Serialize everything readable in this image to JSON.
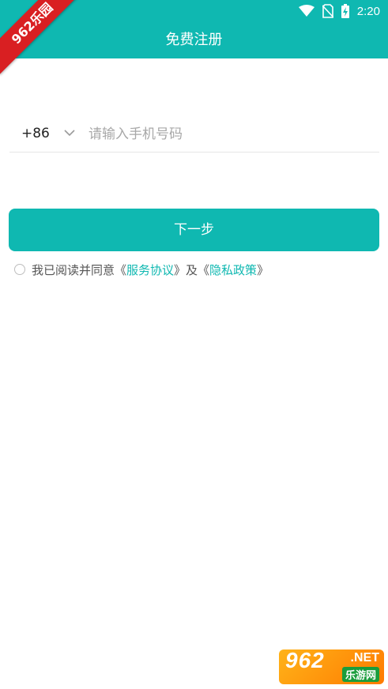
{
  "status_bar": {
    "time": "2:20"
  },
  "ribbon": {
    "text": "962乐园"
  },
  "app_bar": {
    "title": "免费注册"
  },
  "form": {
    "country_code": "+86",
    "phone_placeholder": "请输入手机号码",
    "next_label": "下一步"
  },
  "agreement": {
    "prefix": "我已阅读并同意《",
    "service_link": "服务协议",
    "middle": "》及《",
    "privacy_link": "隐私政策",
    "suffix": "》"
  },
  "watermark": {
    "number": "962",
    "domain": ".NET",
    "subtitle": "乐游网"
  },
  "colors": {
    "accent": "#0fb8b1",
    "ribbon": "#d91f22"
  }
}
